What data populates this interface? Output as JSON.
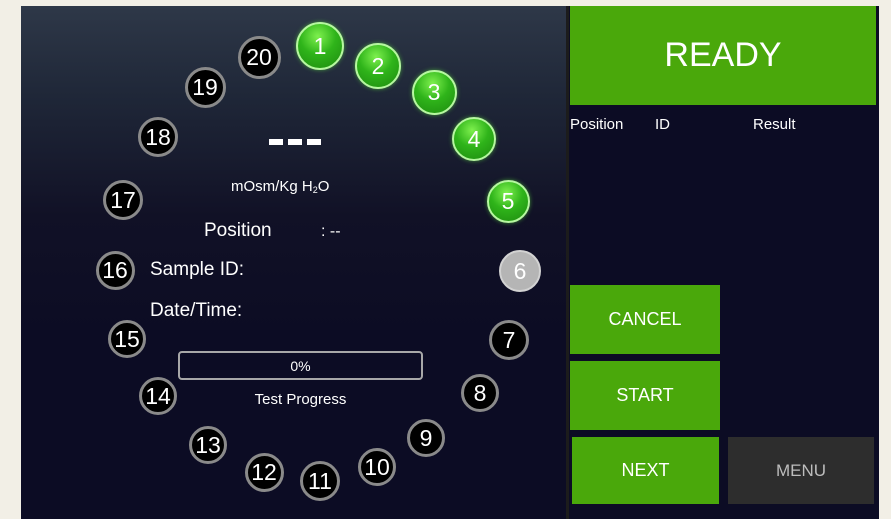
{
  "status": "READY",
  "reading": {
    "units_main": "mOsm/Kg H",
    "units_sub": "2",
    "units_end": "O",
    "position_label": "Position",
    "position_value": ": --",
    "sample_id_label": "Sample ID:",
    "datetime_label": "Date/Time:"
  },
  "progress": {
    "value_text": "0%",
    "fraction": 0,
    "caption": "Test Progress"
  },
  "results_table": {
    "headers": {
      "position": "Position",
      "id": "ID",
      "result": "Result"
    }
  },
  "buttons": {
    "cancel": "CANCEL",
    "start": "START",
    "next": "NEXT",
    "menu": "MENU"
  },
  "carousel": [
    {
      "label": "1",
      "state": "loaded"
    },
    {
      "label": "2",
      "state": "loaded"
    },
    {
      "label": "3",
      "state": "loaded"
    },
    {
      "label": "4",
      "state": "loaded"
    },
    {
      "label": "5",
      "state": "loaded"
    },
    {
      "label": "6",
      "state": "current"
    },
    {
      "label": "7",
      "state": "empty"
    },
    {
      "label": "8",
      "state": "empty"
    },
    {
      "label": "9",
      "state": "empty"
    },
    {
      "label": "10",
      "state": "empty"
    },
    {
      "label": "11",
      "state": "empty"
    },
    {
      "label": "12",
      "state": "empty"
    },
    {
      "label": "13",
      "state": "empty"
    },
    {
      "label": "14",
      "state": "empty"
    },
    {
      "label": "15",
      "state": "empty"
    },
    {
      "label": "16",
      "state": "empty"
    },
    {
      "label": "17",
      "state": "empty"
    },
    {
      "label": "18",
      "state": "empty"
    },
    {
      "label": "19",
      "state": "empty"
    },
    {
      "label": "20",
      "state": "empty"
    }
  ],
  "colors": {
    "accent_green": "#4aa80b",
    "loaded_green": "#2fb41a",
    "current_gray": "#b5b5b5",
    "background": "#0c0c24"
  }
}
